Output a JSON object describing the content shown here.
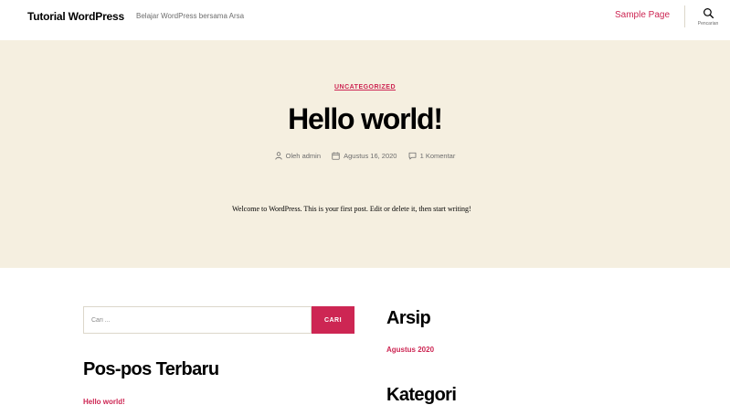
{
  "header": {
    "site_title": "Tutorial WordPress",
    "site_description": "Belajar WordPress bersama Arsa",
    "nav": [
      {
        "label": "Sample Page"
      }
    ],
    "search_toggle_label": "Pencarian"
  },
  "post": {
    "category": "UNCATEGORIZED",
    "title": "Hello world!",
    "meta": {
      "author": "Oleh admin",
      "date": "Agustus 16, 2020",
      "comments": "1 Komentar"
    },
    "content": "Welcome to WordPress. This is your first post. Edit or delete it, then start writing!"
  },
  "widgets": {
    "search": {
      "placeholder": "Cari ...",
      "button_label": "CARI"
    },
    "recent_posts": {
      "title": "Pos-pos Terbaru",
      "items": [
        "Hello world!"
      ]
    },
    "archives": {
      "title": "Arsip",
      "items": [
        "Agustus 2020"
      ]
    },
    "categories": {
      "title": "Kategori"
    }
  },
  "colors": {
    "accent": "#cd2653",
    "hero_bg": "#f5efe0",
    "meta_text": "#6d6d6d"
  }
}
